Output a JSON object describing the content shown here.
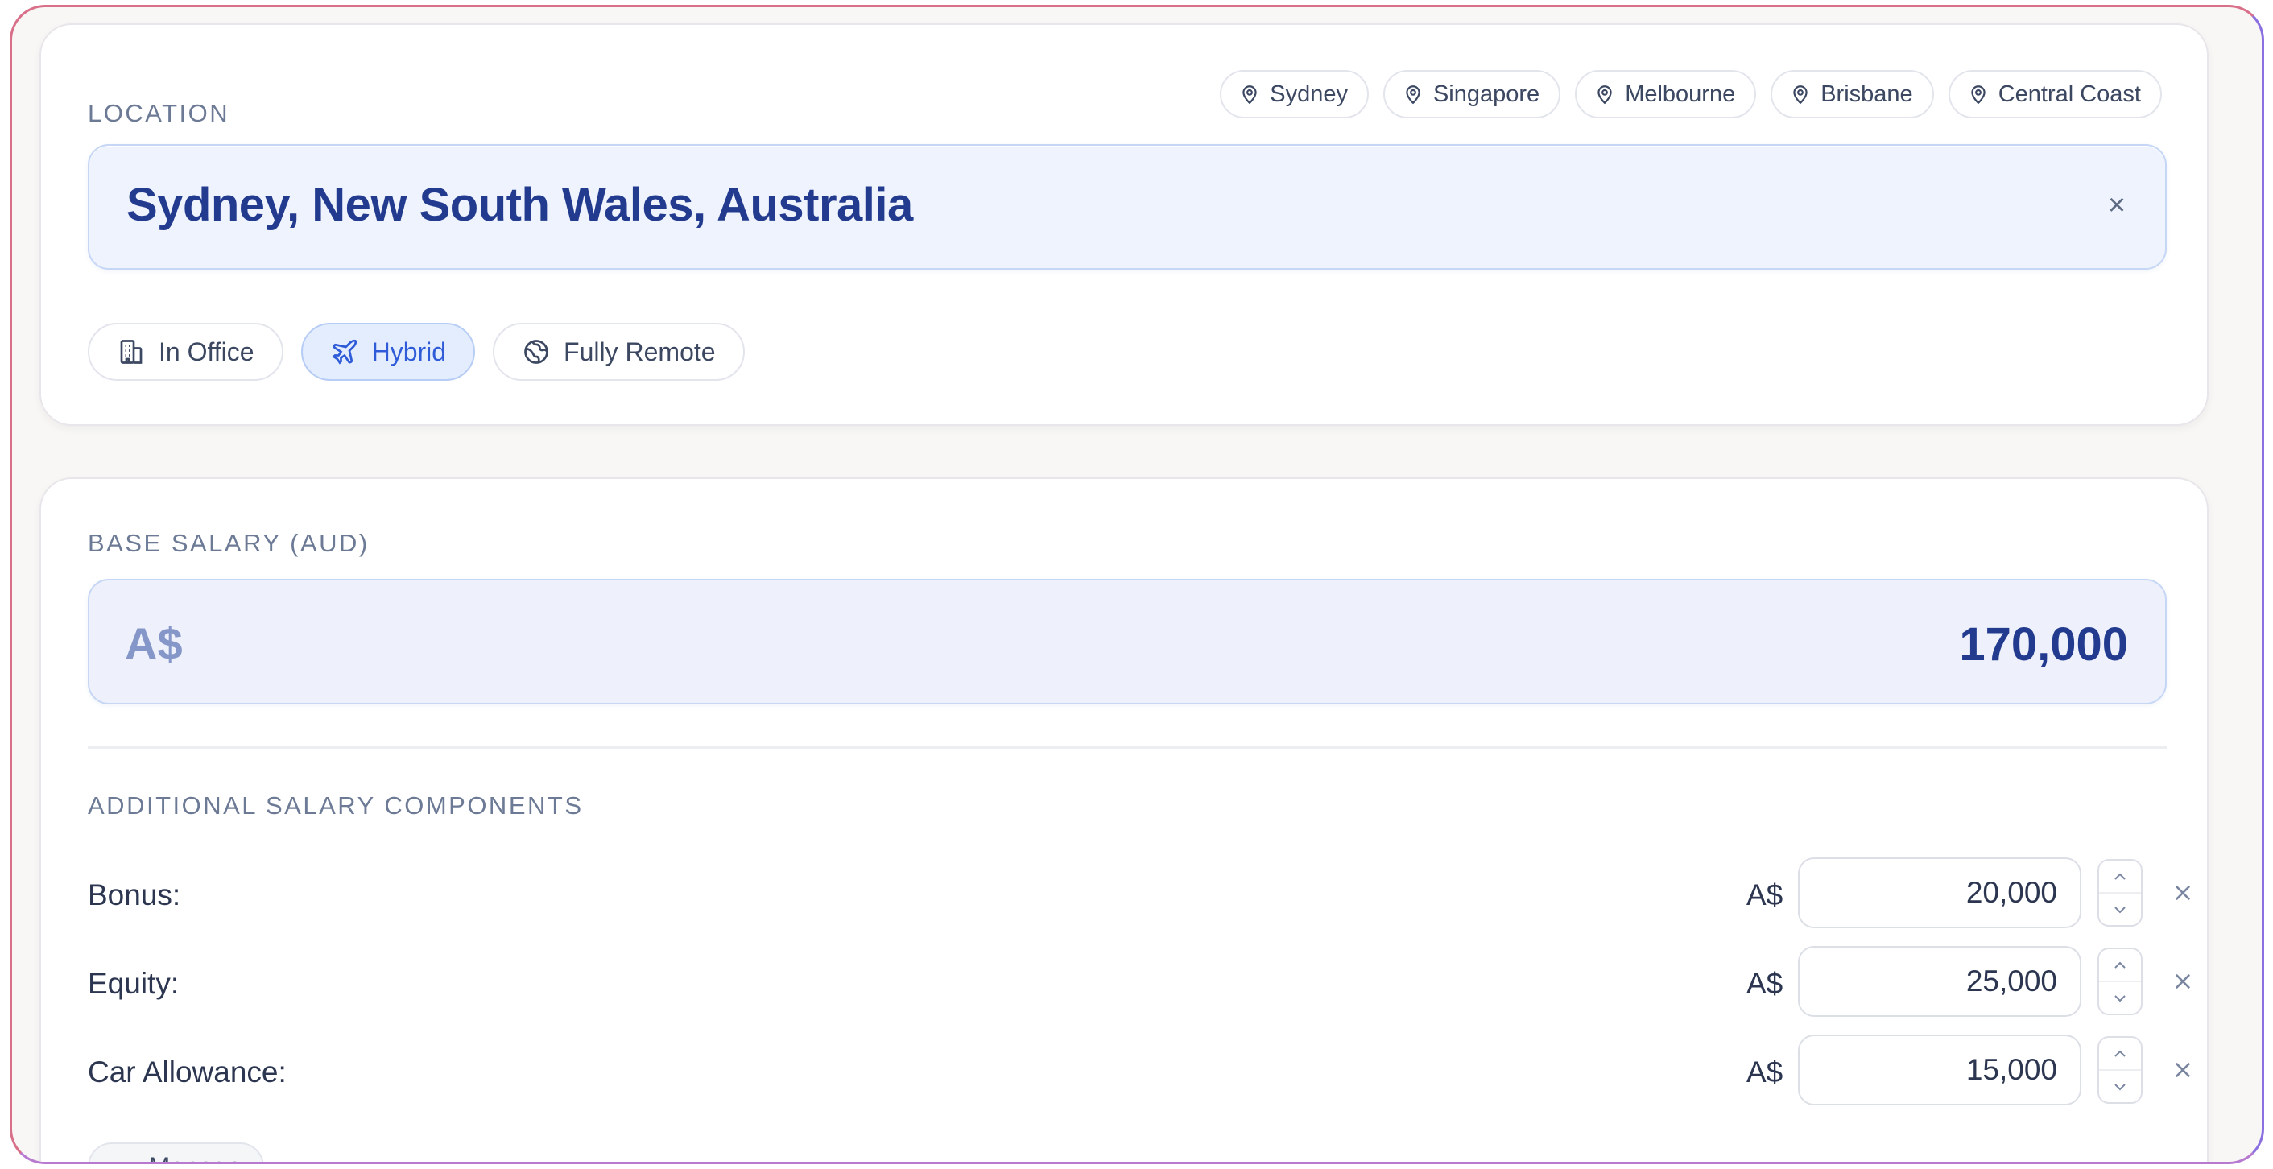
{
  "location": {
    "section_label": "LOCATION",
    "quick_picks": [
      "Sydney",
      "Singapore",
      "Melbourne",
      "Brisbane",
      "Central Coast"
    ],
    "selected": "Sydney, New South Wales, Australia",
    "clear_label": "×",
    "work_modes": [
      {
        "label": "In Office",
        "icon": "building-icon",
        "active": false
      },
      {
        "label": "Hybrid",
        "icon": "plane-icon",
        "active": true
      },
      {
        "label": "Fully Remote",
        "icon": "globe-icon",
        "active": false
      }
    ]
  },
  "salary": {
    "section_label": "BASE SALARY (AUD)",
    "currency": "A$",
    "base_value": "170,000",
    "components_label": "ADDITIONAL SALARY COMPONENTS",
    "components": [
      {
        "label": "Bonus:",
        "currency": "A$",
        "value": "20,000"
      },
      {
        "label": "Equity:",
        "currency": "A$",
        "value": "25,000"
      },
      {
        "label": "Car Allowance:",
        "currency": "A$",
        "value": "15,000"
      }
    ],
    "manage_label": "Manage",
    "manage_icon": "ellipsis-icon"
  },
  "colors": {
    "accent": "#2f5bd8",
    "field_text": "#223b8f",
    "field_bg": "#eef3fd",
    "page_bg": "#f8f7f5"
  }
}
